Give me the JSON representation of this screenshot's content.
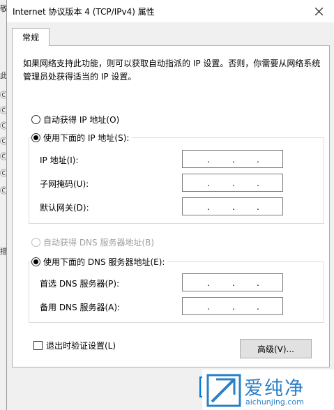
{
  "window": {
    "title": "Internet 协议版本 4 (TCP/IPv4) 属性"
  },
  "tabs": [
    {
      "label": "常规"
    }
  ],
  "description": "如果网络支持此功能，则可以获取自动指派的 IP 设置。否则，你需要从网络系统管理员处获得适当的 IP 设置。",
  "ip_section": {
    "auto_option": "自动获得 IP 地址(O)",
    "manual_option": "使用下面的 IP 地址(S):",
    "selected": "manual",
    "fields": [
      {
        "label": "IP 地址(I):",
        "value": ". . ."
      },
      {
        "label": "子网掩码(U):",
        "value": ". . ."
      },
      {
        "label": "默认网关(D):",
        "value": ". . ."
      }
    ]
  },
  "dns_section": {
    "auto_option": "自动获得 DNS 服务器地址(B)",
    "auto_disabled": true,
    "manual_option": "使用下面的 DNS 服务器地址(E):",
    "selected": "manual",
    "fields": [
      {
        "label": "首选 DNS 服务器(P):",
        "value": ". . ."
      },
      {
        "label": "备用 DNS 服务器(A):",
        "value": ". . ."
      }
    ]
  },
  "validate_checkbox": {
    "label": "退出时验证设置(L)",
    "checked": false
  },
  "buttons": {
    "advanced": "高级(V)..."
  },
  "watermark": {
    "brand": "爱纯净",
    "url": "aichunjing.com"
  },
  "background_glyphs": [
    "敬",
    "此",
    "Ⓒ",
    "Ⓒ",
    "Ⓒ",
    "Ⓒ",
    "Ⓒ",
    "Ⓒ",
    "Ⓒ",
    "描"
  ],
  "colors": {
    "accent": "#0078d7",
    "watermark": "#2a80c8"
  }
}
